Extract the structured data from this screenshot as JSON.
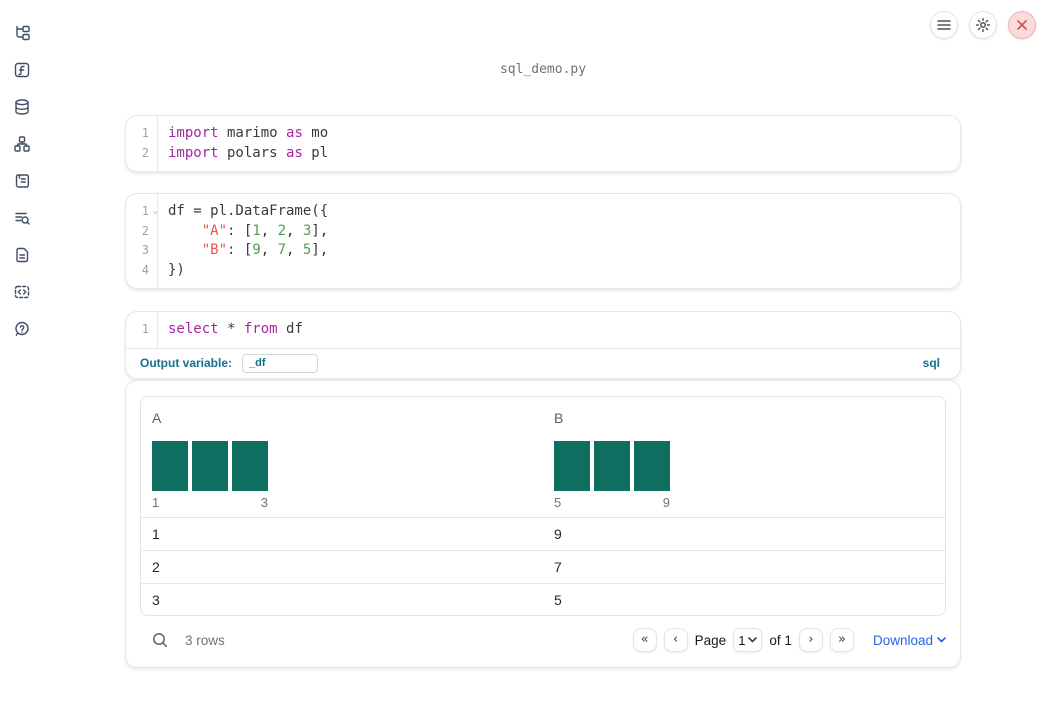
{
  "app": {
    "title": "sql_demo.py"
  },
  "icons": {
    "menu": "hamburger",
    "settings": "gear",
    "close": "x",
    "search": "magnifier",
    "first_page": "«",
    "prev_page": "‹",
    "next_page": "›",
    "last_page": "»",
    "chevron_down": "⌄",
    "fold": "⌄"
  },
  "sidebar": {
    "items": [
      "file-explorer",
      "functions",
      "datasources",
      "dependencies",
      "scratchpad",
      "logs",
      "documentation",
      "snippets",
      "help"
    ]
  },
  "colors": {
    "histogram_bar": "#0E6F60",
    "sql_accent": "#17708F",
    "link_blue": "#2563EB",
    "keyword": "#A626A4",
    "string": "#E45649",
    "number": "#50A14F",
    "code_text": "#383A42"
  },
  "cells": [
    {
      "gutter": [
        {
          "n": "1"
        },
        {
          "n": "2"
        }
      ],
      "lines": [
        [
          [
            "kw",
            "import"
          ],
          [
            "pl",
            " marimo "
          ],
          [
            "kw",
            "as"
          ],
          [
            "pl",
            " mo"
          ]
        ],
        [
          [
            "kw",
            "import"
          ],
          [
            "pl",
            " polars "
          ],
          [
            "kw",
            "as"
          ],
          [
            "pl",
            " pl"
          ]
        ]
      ]
    },
    {
      "gutter": [
        {
          "n": "1",
          "fold": true
        },
        {
          "n": "2"
        },
        {
          "n": "3"
        },
        {
          "n": "4"
        }
      ],
      "lines": [
        [
          [
            "pl",
            "df = pl.DataFrame({"
          ]
        ],
        [
          [
            "pl",
            "    "
          ],
          [
            "str",
            "\"A\""
          ],
          [
            "pl",
            ": ["
          ],
          [
            "num",
            "1"
          ],
          [
            "pl",
            ", "
          ],
          [
            "num",
            "2"
          ],
          [
            "pl",
            ", "
          ],
          [
            "num",
            "3"
          ],
          [
            "pl",
            "],"
          ]
        ],
        [
          [
            "pl",
            "    "
          ],
          [
            "str",
            "\"B\""
          ],
          [
            "pl",
            ": ["
          ],
          [
            "num",
            "9"
          ],
          [
            "pl",
            ", "
          ],
          [
            "num",
            "7"
          ],
          [
            "pl",
            ", "
          ],
          [
            "num",
            "5"
          ],
          [
            "pl",
            "],"
          ]
        ],
        [
          [
            "pl",
            "})"
          ]
        ]
      ]
    },
    {
      "gutter": [
        {
          "n": "1"
        }
      ],
      "lines": [
        [
          [
            "kw",
            "select"
          ],
          [
            "pl",
            " * "
          ],
          [
            "kw",
            "from"
          ],
          [
            "pl",
            " df"
          ]
        ]
      ]
    }
  ],
  "sql_cell": {
    "output_variable_label": "Output variable:",
    "output_variable_value": "_df",
    "language_badge": "sql"
  },
  "table": {
    "columns": [
      {
        "name": "A",
        "hist": {
          "values": [
            1,
            1,
            1
          ],
          "min_label": "1",
          "max_label": "3"
        }
      },
      {
        "name": "B",
        "hist": {
          "values": [
            1,
            1,
            1
          ],
          "min_label": "5",
          "max_label": "9"
        }
      }
    ],
    "rows": [
      [
        "1",
        "9"
      ],
      [
        "2",
        "7"
      ],
      [
        "3",
        "5"
      ]
    ],
    "footer": {
      "row_count": "3 rows",
      "page_label": "Page",
      "page_value": "1",
      "of_label": "of 1",
      "download_label": "Download"
    }
  },
  "chart_data": [
    {
      "type": "bar",
      "title": "Column A distribution",
      "categories": [
        1,
        2,
        3
      ],
      "values": [
        1,
        1,
        1
      ],
      "x_tick_labels": [
        "1",
        "3"
      ],
      "bar_color": "#0E6F60",
      "grid": false
    },
    {
      "type": "bar",
      "title": "Column B distribution",
      "categories": [
        5,
        7,
        9
      ],
      "values": [
        1,
        1,
        1
      ],
      "x_tick_labels": [
        "5",
        "9"
      ],
      "bar_color": "#0E6F60",
      "grid": false
    }
  ]
}
